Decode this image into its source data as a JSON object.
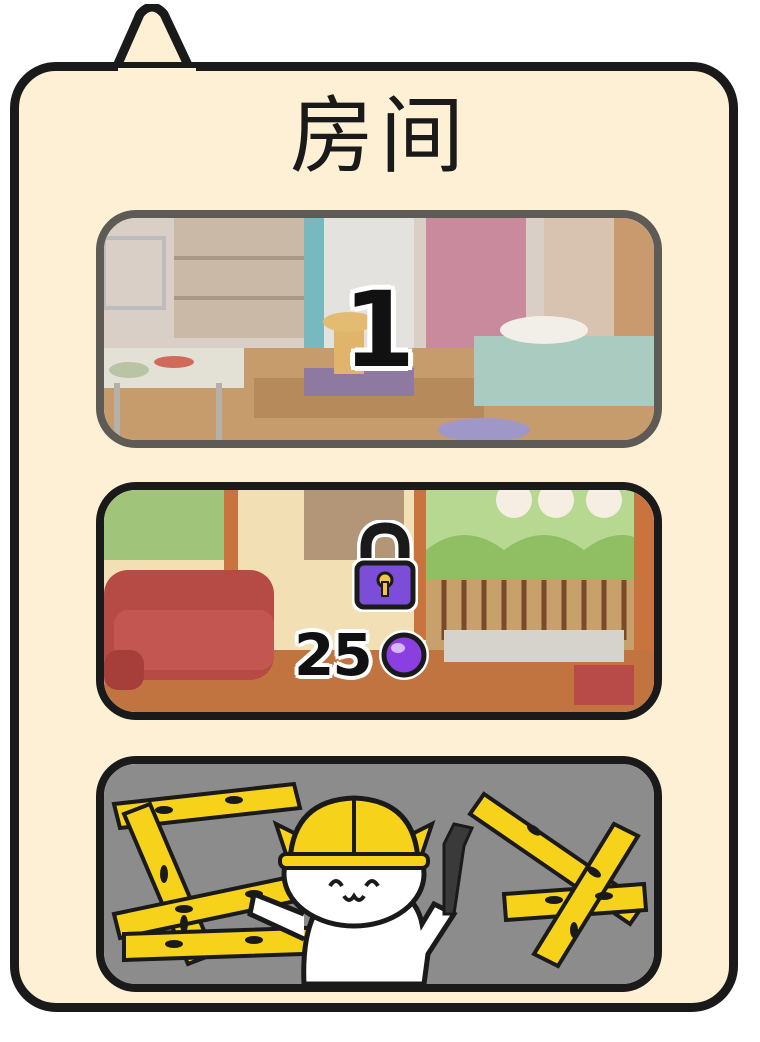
{
  "panel": {
    "title": "房间"
  },
  "rooms": [
    {
      "label": "1",
      "state": "current",
      "scene": "bedroom"
    },
    {
      "state": "locked",
      "price": "25",
      "currency_icon": "purple-gem-icon",
      "scene": "living-room-with-porch"
    },
    {
      "state": "under-construction",
      "icon": "construction-cat-icon"
    }
  ],
  "colors": {
    "panel_bg": "#fdf0d5",
    "outline": "#1a1a1a",
    "lock_purple": "#7c4dd6",
    "gem_purple": "#8b3fe0",
    "caution_yellow": "#f6d21b",
    "construction_bg": "#8c8c8c"
  }
}
